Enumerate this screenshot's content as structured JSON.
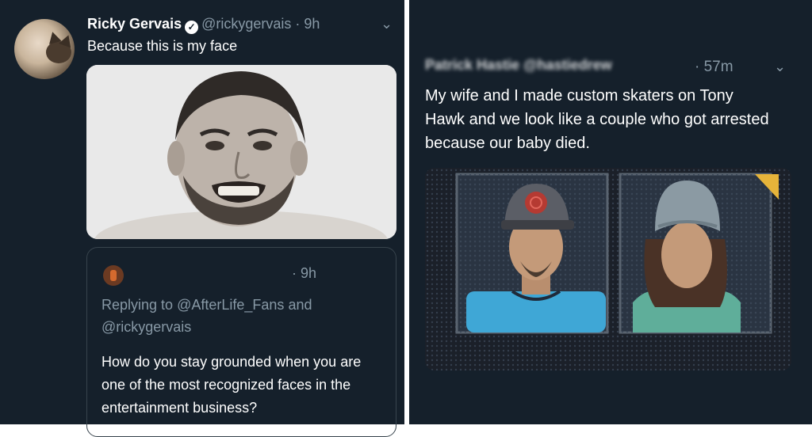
{
  "left_tweet": {
    "display_name": "Ricky Gervais",
    "handle": "@rickygervais",
    "time": "· 9h",
    "text": "Because this is my face",
    "quoted": {
      "time": "· 9h",
      "replying_prefix": "Replying to",
      "replying_to_1": "@AfterLife_Fans",
      "replying_and": "and",
      "replying_to_2": "@rickygervais",
      "text": "How do you stay grounded when you are one of the most recognized faces in the entertainment business?"
    }
  },
  "right_tweet": {
    "display_name_obscured": "Patrick Hastie @hastiedrew",
    "time": "· 57m",
    "text": "My wife and I made custom skaters on Tony Hawk and we look like a couple who got arrested because our baby died."
  },
  "colors": {
    "background": "#15202b",
    "text_primary": "#ffffff",
    "text_secondary": "#8899a6",
    "border": "#38444d"
  },
  "icons": [
    "verified-badge-icon",
    "chevron-down-icon",
    "chevron-down-icon"
  ]
}
